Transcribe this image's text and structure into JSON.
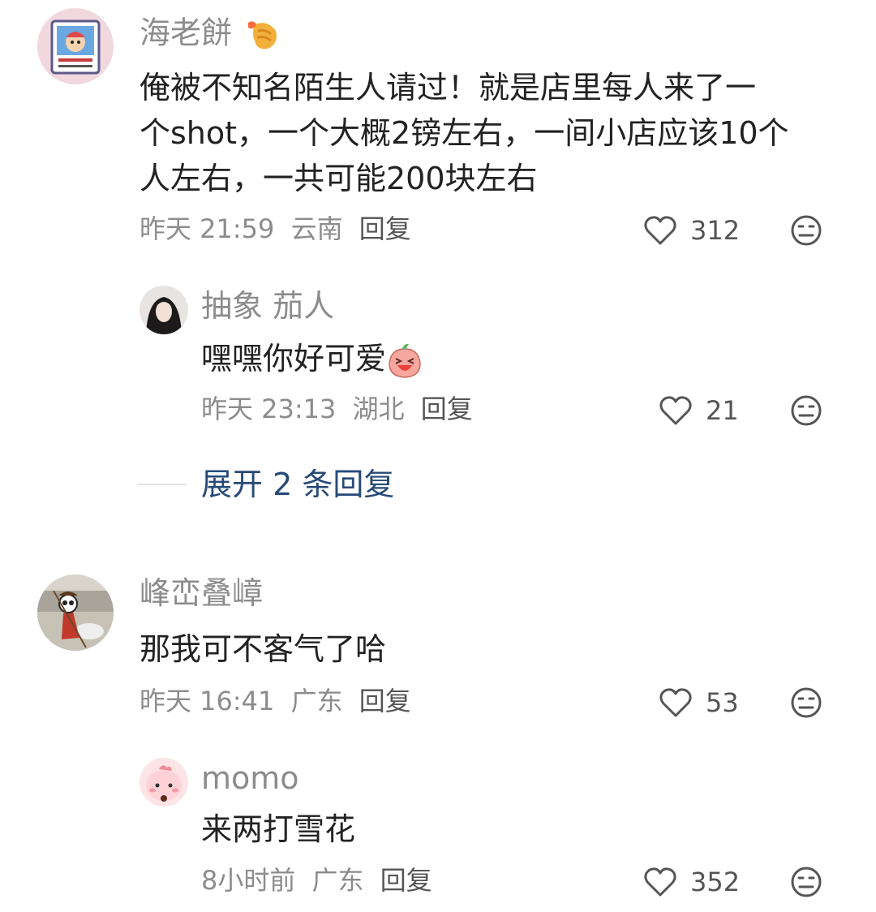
{
  "comments": [
    {
      "username": "海老餅",
      "text_lines": [
        "俺被不知名陌生人请过！就是店里每人来了一",
        "个shot，一个大概2镑左右，一间小店应该10个",
        "人左右，一共可能200块左右"
      ],
      "time": "昨天 21:59",
      "location": "云南",
      "reply_label": "回复",
      "likes": "312"
    },
    {
      "username": "抽象 茄人",
      "text": "嘿嘿你好可爱",
      "time": "昨天 23:13",
      "location": "湖北",
      "reply_label": "回复",
      "likes": "21"
    },
    {
      "username": "峰峦叠嶂",
      "text": "那我可不客气了哈",
      "time": "昨天 16:41",
      "location": "广东",
      "reply_label": "回复",
      "likes": "53"
    },
    {
      "username": "momo",
      "text": "来两打雪花",
      "time": "8小时前",
      "location": "广东",
      "reply_label": "回复",
      "likes": "352"
    }
  ],
  "expand_replies": "展开 2 条回复",
  "icons": {
    "like": "heart-outline-icon",
    "dislike": "meh-face-icon",
    "username_badge": "fried-shrimp-emoji",
    "inline_emoji": "laughing-peach-emoji"
  },
  "colors": {
    "username": "#8c8c8c",
    "text": "#222222",
    "expand_link": "#274a78"
  }
}
